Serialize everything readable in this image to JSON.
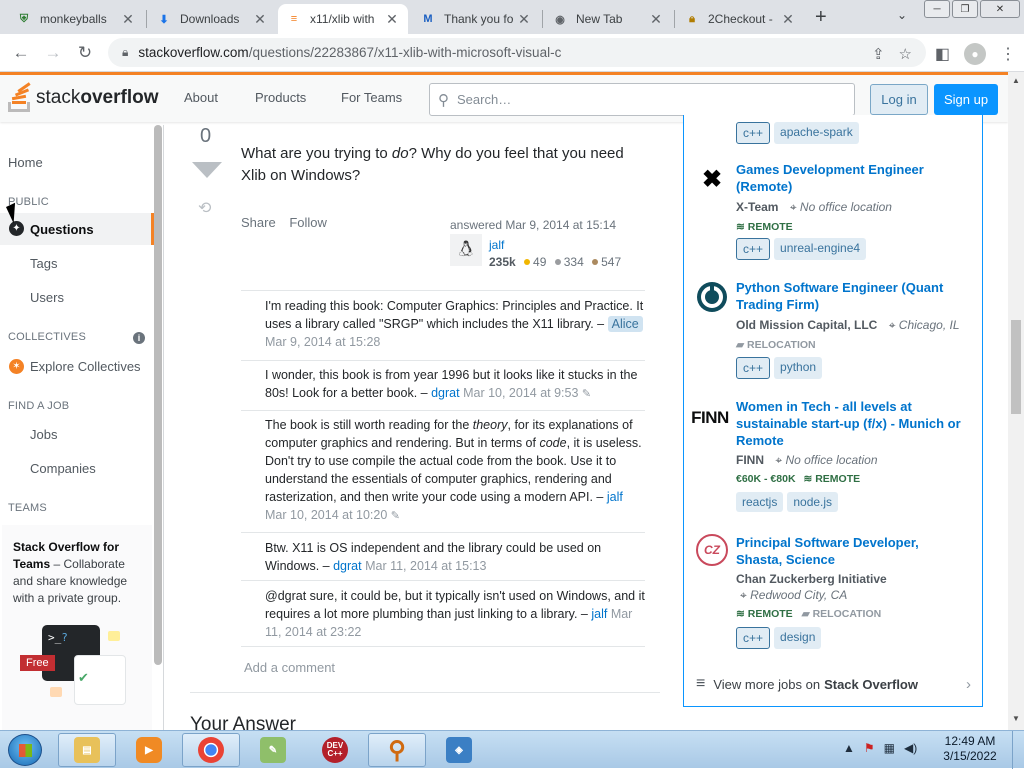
{
  "browser": {
    "tabs": [
      {
        "title": "monkeyballs",
        "icon": "shield-icon"
      },
      {
        "title": "Downloads",
        "icon": "download-icon"
      },
      {
        "title": "x11/xlib with",
        "icon": "stackoverflow-icon"
      },
      {
        "title": "Thank you fo",
        "icon": "malwarebytes-icon"
      },
      {
        "title": "New Tab",
        "icon": "chrome-icon"
      },
      {
        "title": "2Checkout -",
        "icon": "lock-icon"
      }
    ],
    "url_domain": "stackoverflow.com",
    "url_path": "/questions/22283867/x11-xlib-with-microsoft-visual-c"
  },
  "header": {
    "logo_text_light": "stack",
    "logo_text_bold": "overflow",
    "nav": [
      "About",
      "Products",
      "For Teams"
    ],
    "search_placeholder": "Search…",
    "login": "Log in",
    "signup": "Sign up"
  },
  "sidebar": {
    "home": "Home",
    "public_heading": "PUBLIC",
    "questions": "Questions",
    "tags": "Tags",
    "users": "Users",
    "collectives_heading": "COLLECTIVES",
    "explore_collectives": "Explore Collectives",
    "find_job_heading": "FIND A JOB",
    "jobs": "Jobs",
    "companies": "Companies",
    "teams_heading": "TEAMS",
    "teams_title": "Stack Overflow for Teams",
    "teams_desc": "– Collaborate and share knowledge with a private group.",
    "free_badge": "Free"
  },
  "answer": {
    "vote_count": "0",
    "text_pre": "What are you trying to ",
    "text_em": "do",
    "text_post": "? Why do you feel that you need Xlib on Windows?",
    "share": "Share",
    "follow": "Follow",
    "answered": "answered Mar 9, 2014 at 15:14",
    "user": "jalf",
    "rep": "235k",
    "gold": "49",
    "silver": "334",
    "bronze": "547"
  },
  "comments": [
    {
      "text": "I'm reading this book: Computer Graphics: Principles and Practice. It uses a library called \"SRGP\" which includes the X11 library. –",
      "user": "Alice",
      "date": "Mar 9, 2014 at 15:28"
    },
    {
      "text": "I wonder, this book is from year 1996 but it looks like it stucks in the 80s! Look for a better book. –",
      "user": "dgrat",
      "date": "Mar 10, 2014 at 9:53"
    },
    {
      "text_a": "The book is still worth reading for the ",
      "em_a": "theory",
      "text_b": ", for its explanations of computer graphics and rendering. But in terms of ",
      "em_b": "code",
      "text_c": ", it is useless. Don't try to use compile the actual code from the book. Use it to understand the essentials of computer graphics, rendering and rasterization, and then write your code using a modern API. –",
      "user": "jalf",
      "date": "Mar 10, 2014 at 10:20"
    },
    {
      "text": "Btw. X11 is OS independent and the library could be used on Windows. –",
      "user": "dgrat",
      "date": "Mar 11, 2014 at 15:13"
    },
    {
      "text": "@dgrat sure, it could be, but it typically isn't used on Windows, and it requires a lot more plumbing than just linking to a library. –",
      "user": "jalf",
      "date": "Mar 11, 2014 at 23:22"
    }
  ],
  "add_comment": "Add a comment",
  "your_answer": "Your Answer",
  "jobs": {
    "top_tags": [
      "c++",
      "apache-spark"
    ],
    "items": [
      {
        "title": "Games Development Engineer (Remote)",
        "company": "X-Team",
        "location": "No office location",
        "meta": [
          "REMOTE"
        ],
        "tags": [
          "c++",
          "unreal-engine4"
        ],
        "logo_icon": "x-team-logo"
      },
      {
        "title": "Python Software Engineer (Quant Trading Firm)",
        "company": "Old Mission Capital, LLC",
        "location": "Chicago, IL",
        "meta": [
          "RELOCATION"
        ],
        "tags": [
          "c++",
          "python"
        ],
        "logo_icon": "old-mission-logo"
      },
      {
        "title": "Women in Tech - all levels at sustainable start-up (f/x) - Munich or Remote",
        "company": "FINN",
        "location": "No office location",
        "salary": "€60K - €80K",
        "meta": [
          "REMOTE"
        ],
        "tags": [
          "reactjs",
          "node.js"
        ],
        "logo_icon": "finn-logo",
        "logo_text": "FINN"
      },
      {
        "title": "Principal Software Developer, Shasta, Science",
        "company": "Chan Zuckerberg Initiative",
        "location": "Redwood City, CA",
        "meta": [
          "REMOTE",
          "RELOCATION"
        ],
        "tags": [
          "c++",
          "design"
        ],
        "logo_icon": "czi-logo",
        "logo_text": "CZ"
      }
    ],
    "view_more_pre": "View more jobs on",
    "view_more_brand": "Stack Overflow"
  },
  "taskbar": {
    "time": "12:49 AM",
    "date": "3/15/2022",
    "devcpp_label": "DEV C++"
  },
  "colors": {
    "so_orange": "#f48225",
    "so_blue": "#0a95ff",
    "link_blue": "#0074cc"
  }
}
